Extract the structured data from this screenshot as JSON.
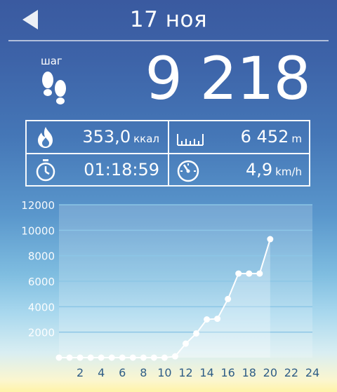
{
  "header": {
    "date": "17 ноя",
    "back_icon": "back-arrow-icon"
  },
  "steps": {
    "label": "шаг",
    "value": "9 218",
    "icon": "footprints-icon"
  },
  "stats": {
    "calories": {
      "value": "353,0",
      "unit": "ккал",
      "icon": "flame-icon"
    },
    "distance": {
      "value": "6 452",
      "unit": "m",
      "icon": "ruler-icon"
    },
    "duration": {
      "value": "01:18:59",
      "icon": "stopwatch-icon"
    },
    "speed": {
      "value": "4,9",
      "unit": "km/h",
      "icon": "speedometer-icon"
    }
  },
  "chart_data": {
    "type": "line",
    "title": "",
    "xlabel": "",
    "ylabel": "",
    "x": [
      0,
      1,
      2,
      3,
      4,
      5,
      6,
      7,
      8,
      9,
      10,
      11,
      12,
      13,
      14,
      15,
      16,
      17,
      18,
      19,
      20
    ],
    "values": [
      0,
      0,
      0,
      0,
      0,
      0,
      0,
      0,
      0,
      0,
      0,
      100,
      1100,
      1900,
      3000,
      3050,
      4600,
      6600,
      6600,
      6600,
      9300
    ],
    "xlim": [
      0,
      24
    ],
    "ylim": [
      0,
      12000
    ],
    "x_ticks": [
      "2",
      "4",
      "6",
      "8",
      "10",
      "12",
      "14",
      "16",
      "18",
      "20",
      "22",
      "24"
    ],
    "y_ticks": [
      "2000",
      "4000",
      "6000",
      "8000",
      "10000",
      "12000"
    ],
    "grid": true,
    "colors": {
      "line": "#ffffff",
      "area": "rgba(255,255,255,0.25)",
      "grid": "#8cc6e6"
    }
  }
}
